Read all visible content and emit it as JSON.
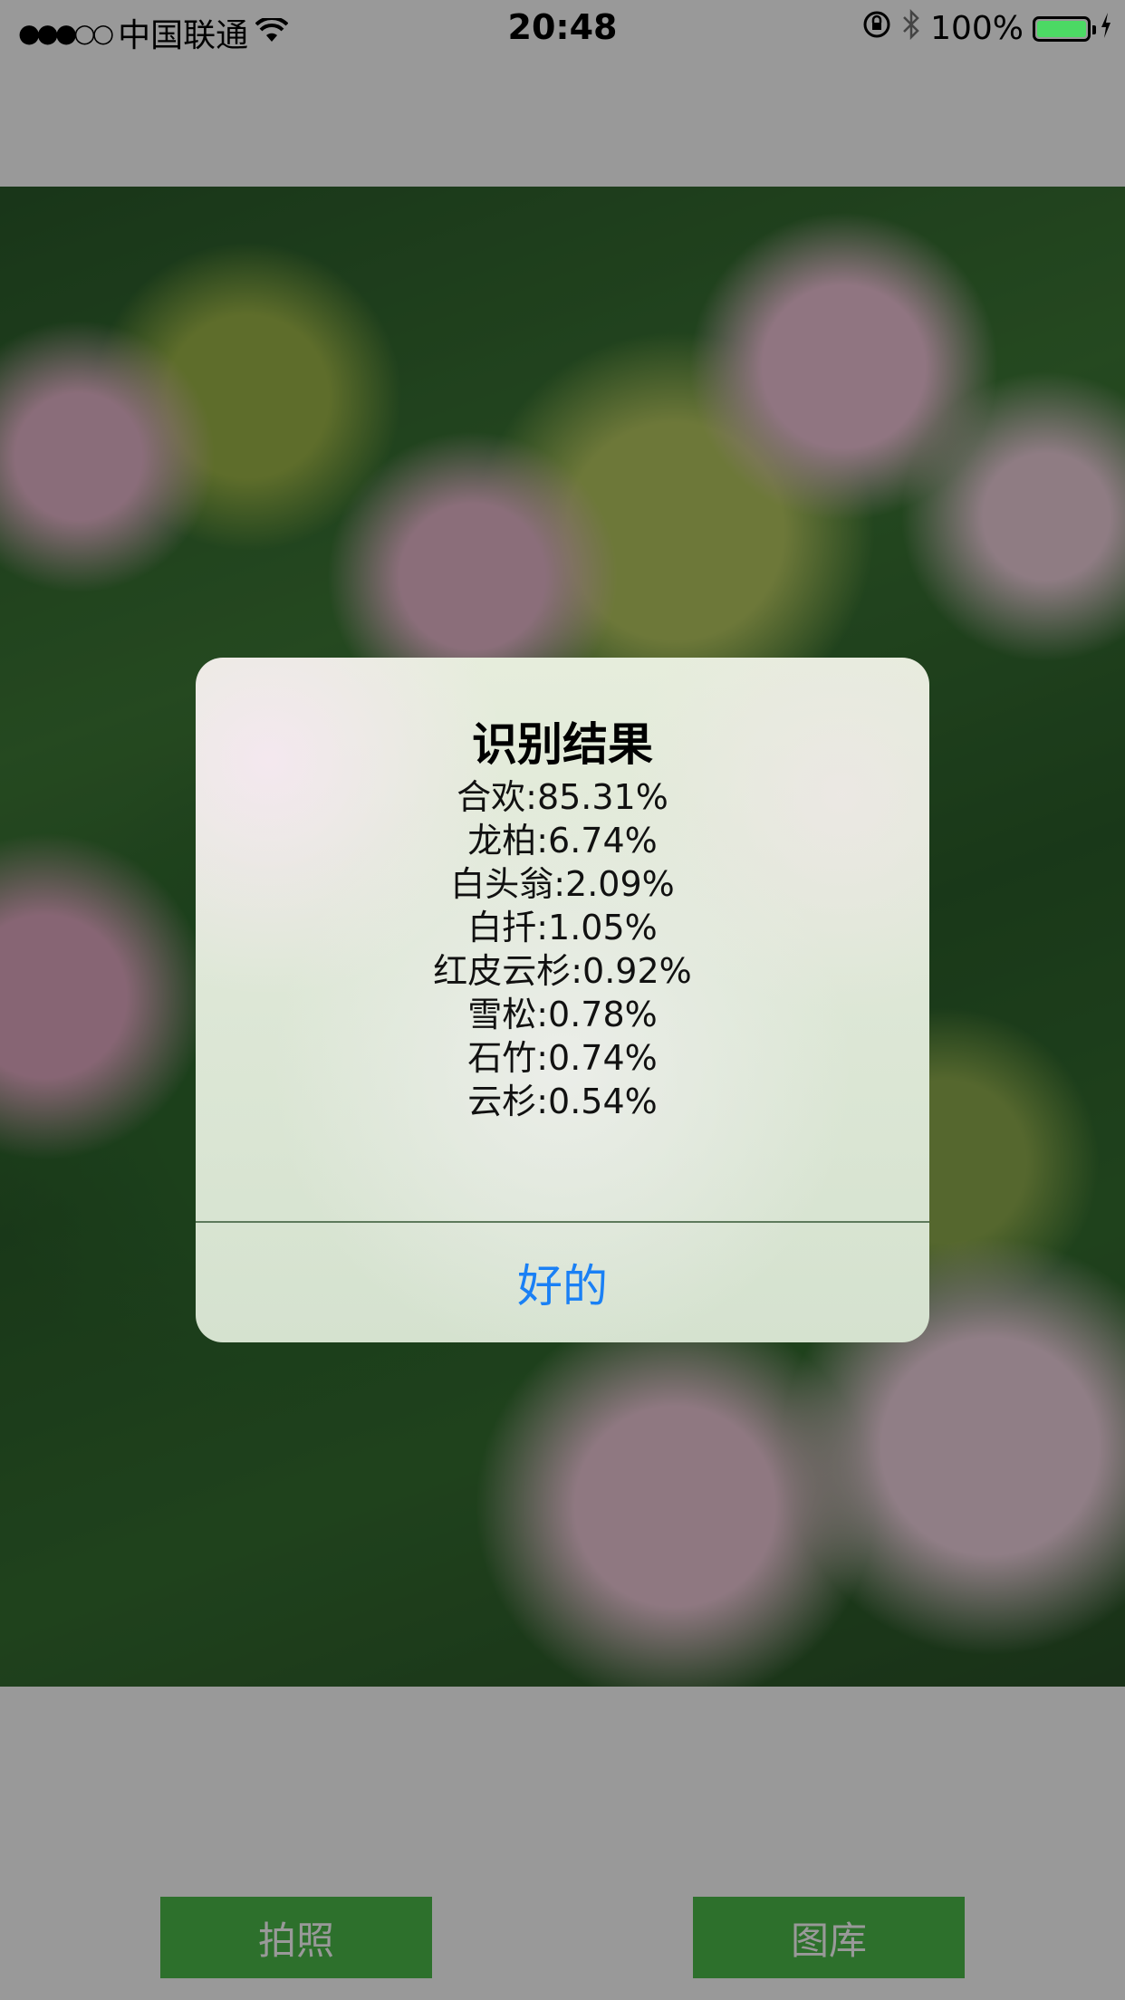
{
  "status_bar": {
    "signal": "●●●○○",
    "carrier": "中国联通",
    "wifi_icon": "wifi-icon",
    "time": "20:48",
    "orientation_lock_icon": "orientation-lock-icon",
    "bluetooth_icon": "bluetooth-icon",
    "battery_percent": "100%",
    "battery_level": 1.0,
    "battery_color": "#4cd964"
  },
  "alert": {
    "title": "识别结果",
    "results": [
      "合欢:85.31%",
      "龙柏:6.74%",
      "白头翁:2.09%",
      "白扦:1.05%",
      "红皮云杉:0.92%",
      "雪松:0.78%",
      "石竹:0.74%",
      "云杉:0.54%"
    ],
    "ok_label": "好的",
    "ok_color": "#1a80f5"
  },
  "toolbar": {
    "camera_label": "拍照",
    "album_label": "图库",
    "button_color": "#4cbb4a"
  }
}
